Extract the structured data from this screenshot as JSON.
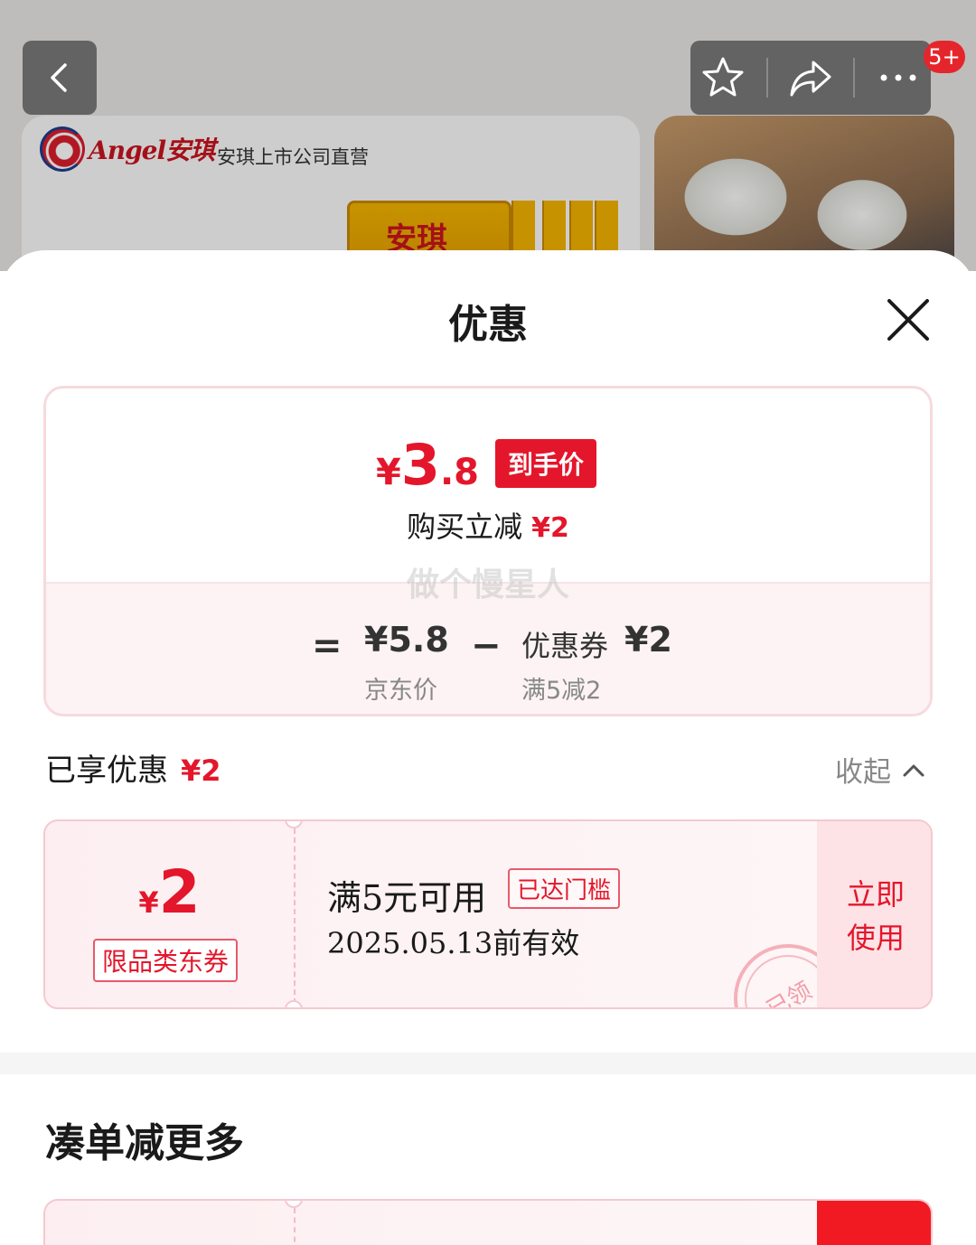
{
  "background": {
    "brand_logo_text": "Angel安琪",
    "brand_subtitle": "安琪上市公司直营",
    "package_text": "安琪",
    "cart_badge": "5+"
  },
  "sheet": {
    "title": "优惠",
    "final_price": {
      "currency": "¥",
      "integer": "3",
      "decimal": ".8",
      "tag": "到手价"
    },
    "save_line": {
      "label": "购买立减",
      "amount": "¥2"
    },
    "watermark": "做个慢星人",
    "calculation": {
      "equals": "=",
      "minus": "−",
      "jd_price": "¥5.8",
      "jd_price_label": "京东价",
      "coupon_label": "优惠券",
      "coupon_amount": "¥2",
      "coupon_rule": "满5减2"
    },
    "enjoyed": {
      "label": "已享优惠",
      "amount": "¥2",
      "collapse_label": "收起"
    },
    "coupon": {
      "currency": "¥",
      "amount": "2",
      "type": "限品类东券",
      "condition": "满5元可用",
      "reached_badge": "已达门槛",
      "valid_until": "2025.05.13前有效",
      "stamp": "已领",
      "use_button": "立即使用"
    },
    "more_section_title": "凑单减更多"
  },
  "colors": {
    "accent_red": "#e4162b",
    "coupon_bg": "#fdeff1",
    "use_button_bg": "#fde2e6"
  },
  "icons": [
    "back-arrow-icon",
    "star-icon",
    "share-icon",
    "more-dots-icon",
    "close-icon",
    "chevron-up-icon"
  ]
}
